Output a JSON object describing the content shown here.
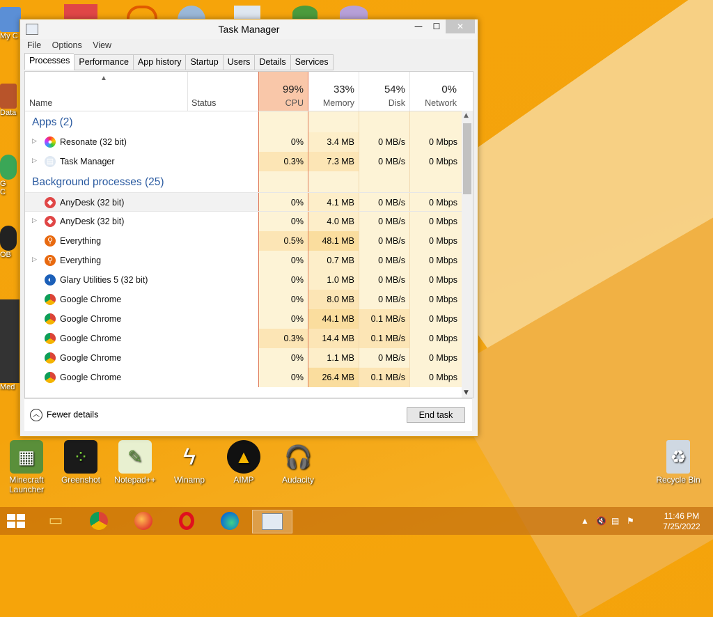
{
  "window": {
    "title": "Task Manager",
    "menu": [
      "File",
      "Options",
      "View"
    ],
    "tabs": [
      "Processes",
      "Performance",
      "App history",
      "Startup",
      "Users",
      "Details",
      "Services"
    ],
    "active_tab": "Processes"
  },
  "header": {
    "name": "Name",
    "status": "Status",
    "cpu_pct": "99%",
    "cpu": "CPU",
    "mem_pct": "33%",
    "mem": "Memory",
    "disk_pct": "54%",
    "disk": "Disk",
    "net_pct": "0%",
    "net": "Network"
  },
  "groups": {
    "apps": "Apps (2)",
    "background": "Background processes (25)"
  },
  "apps": [
    {
      "name": "Resonate (32 bit)",
      "cpu": "0%",
      "mem": "3.4 MB",
      "disk": "0 MB/s",
      "net": "0 Mbps"
    },
    {
      "name": "Task Manager",
      "cpu": "0.3%",
      "mem": "7.3 MB",
      "disk": "0 MB/s",
      "net": "0 Mbps"
    }
  ],
  "background": [
    {
      "name": "AnyDesk (32 bit)",
      "cpu": "0%",
      "mem": "4.1 MB",
      "disk": "0 MB/s",
      "net": "0 Mbps"
    },
    {
      "name": "AnyDesk (32 bit)",
      "cpu": "0%",
      "mem": "4.0 MB",
      "disk": "0 MB/s",
      "net": "0 Mbps"
    },
    {
      "name": "Everything",
      "cpu": "0.5%",
      "mem": "48.1 MB",
      "disk": "0 MB/s",
      "net": "0 Mbps"
    },
    {
      "name": "Everything",
      "cpu": "0%",
      "mem": "0.7 MB",
      "disk": "0 MB/s",
      "net": "0 Mbps"
    },
    {
      "name": "Glary Utilities 5 (32 bit)",
      "cpu": "0%",
      "mem": "1.0 MB",
      "disk": "0 MB/s",
      "net": "0 Mbps"
    },
    {
      "name": "Google Chrome",
      "cpu": "0%",
      "mem": "8.0 MB",
      "disk": "0 MB/s",
      "net": "0 Mbps"
    },
    {
      "name": "Google Chrome",
      "cpu": "0%",
      "mem": "44.1 MB",
      "disk": "0.1 MB/s",
      "net": "0 Mbps"
    },
    {
      "name": "Google Chrome",
      "cpu": "0.3%",
      "mem": "14.4 MB",
      "disk": "0.1 MB/s",
      "net": "0 Mbps"
    },
    {
      "name": "Google Chrome",
      "cpu": "0%",
      "mem": "1.1 MB",
      "disk": "0 MB/s",
      "net": "0 Mbps"
    },
    {
      "name": "Google Chrome",
      "cpu": "0%",
      "mem": "26.4 MB",
      "disk": "0.1 MB/s",
      "net": "0 Mbps"
    }
  ],
  "footer": {
    "fewer": "Fewer details",
    "end_task": "End task"
  },
  "desktop": {
    "icons": [
      "Minecraft Launcher",
      "Greenshot",
      "Notepad++",
      "Winamp",
      "AIMP",
      "Audacity",
      "Recycle Bin"
    ],
    "left_clips": [
      "My C",
      "Data",
      "G",
      "C",
      "OB",
      "Med"
    ]
  },
  "taskbar": {
    "time": "11:46 PM",
    "date": "7/25/2022"
  }
}
